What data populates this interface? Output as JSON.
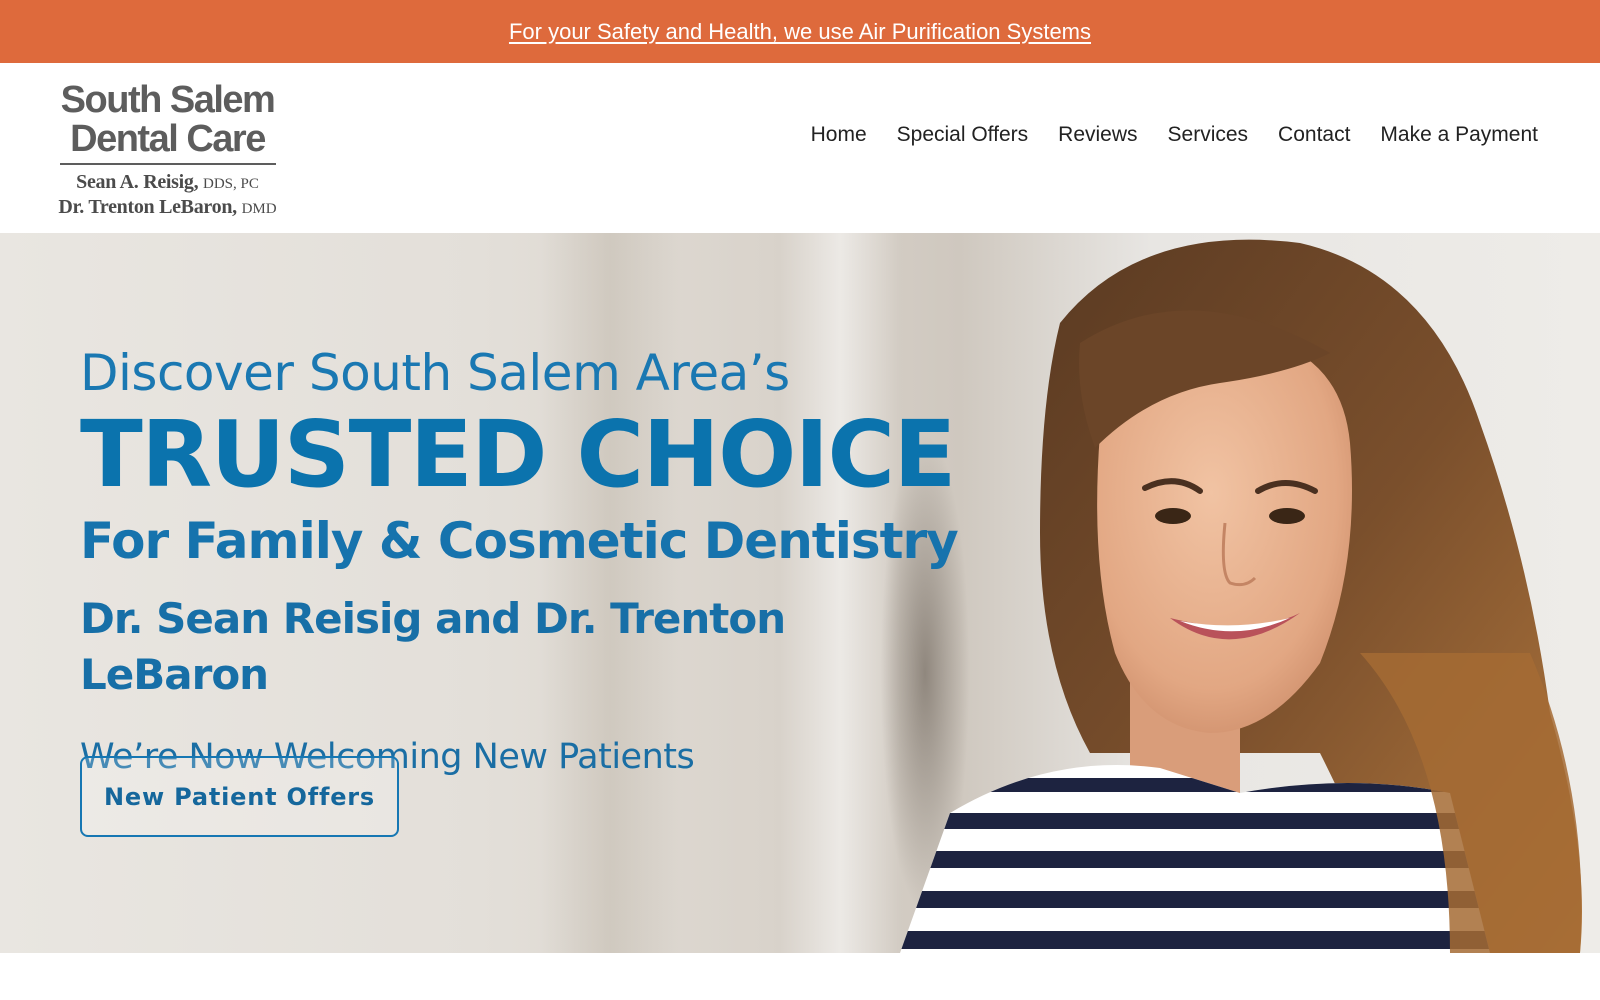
{
  "announcement": {
    "text": "For your Safety and Health, we use Air Purification Systems"
  },
  "logo": {
    "line1": "South Salem",
    "line2": "Dental Care",
    "doctor1_name": "Sean A. Reisig,",
    "doctor1_cred": "DDS, PC",
    "doctor2_name": "Dr. Trenton LeBaron,",
    "doctor2_cred": "DMD"
  },
  "nav": {
    "items": [
      {
        "label": "Home"
      },
      {
        "label": "Special Offers"
      },
      {
        "label": "Reviews"
      },
      {
        "label": "Services"
      },
      {
        "label": "Contact"
      },
      {
        "label": "Make a Payment"
      }
    ]
  },
  "hero": {
    "line1": "Discover South Salem Area’s",
    "line2": "TRUSTED CHOICE",
    "line3": "For Family & Cosmetic Dentistry",
    "doctors": "Dr. Sean Reisig and Dr. Trenton LeBaron",
    "welcome": "We’re Now Welcoming New Patients",
    "cta_label": "New Patient Offers",
    "photo": "smiling-woman-striped-shirt"
  },
  "colors": {
    "announcement_bg": "#de6a3c",
    "brand_blue": "#0b73ad",
    "logo_gray": "#5d5d5d"
  }
}
